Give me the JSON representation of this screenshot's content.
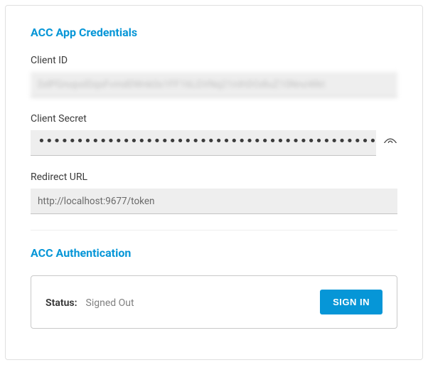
{
  "credentials": {
    "title": "ACC App Credentials",
    "client_id": {
      "label": "Client ID",
      "value": "DdPGnopslDqsFvmd0Wnk0s1FF16LGVNq21nXt0OdluZ10NnoWkt"
    },
    "client_secret": {
      "label": "Client Secret",
      "value": "••••••••••••••••••••••••••••••••••••••••••••••••••••••••••••••••"
    },
    "redirect_url": {
      "label": "Redirect URL",
      "value": "http://localhost:9677/token"
    }
  },
  "authentication": {
    "title": "ACC Authentication",
    "status_label": "Status:",
    "status_value": "Signed Out",
    "signin_label": "SIGN IN"
  }
}
